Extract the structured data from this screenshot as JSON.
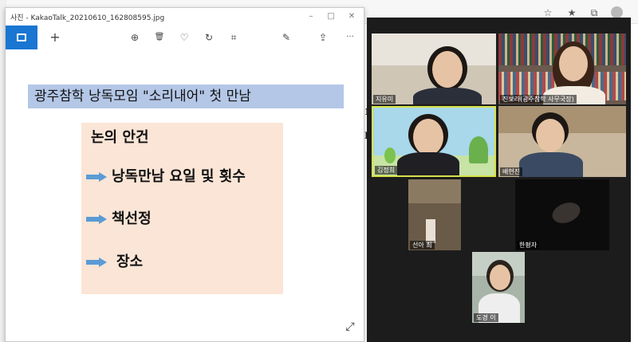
{
  "viewer": {
    "title": "사진 - KakaoTalk_20210610_162808595.jpg",
    "window_buttons": [
      "–",
      "□",
      "✕"
    ],
    "toolbar_icons": [
      "gallery-icon",
      "add-icon",
      "zoom-in-icon",
      "delete-icon",
      "favorite-icon",
      "rotate-icon",
      "crop-icon",
      "edit-icon",
      "share-icon",
      "more-icon"
    ],
    "toolbar_glyphs": {
      "add": "+",
      "zoom": "⊕",
      "delete": "🗑",
      "favorite": "♡",
      "rotate": "↻",
      "crop": "⌗",
      "edit": "✎",
      "share": "⇪",
      "more": "···"
    }
  },
  "slide": {
    "title": "광주참학 낭독모임 \"소리내어\" 첫 만남",
    "agenda_heading": "논의 안건",
    "items": [
      "낭독만남 요일 및 횟수",
      "책선정",
      "장소"
    ],
    "colors": {
      "title_bg": "#b4c7e7",
      "box_bg": "#fbe5d6",
      "arrow": "#5b9bd5"
    }
  },
  "participants": [
    {
      "name": "지유미"
    },
    {
      "name": "진보라(광주참학 사무국장)"
    },
    {
      "name": "김정희"
    },
    {
      "name": "배현진"
    },
    {
      "name": "선아 최"
    },
    {
      "name": "한평자"
    },
    {
      "name": "도경 이"
    }
  ]
}
